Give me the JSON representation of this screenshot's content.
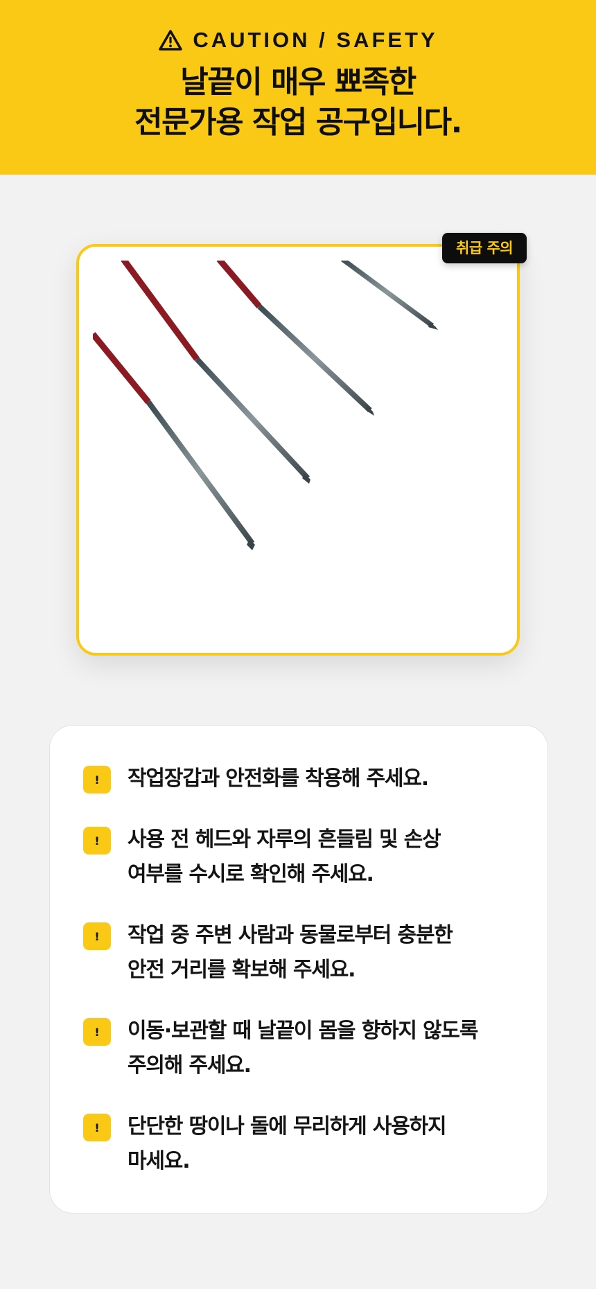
{
  "banner": {
    "caution_label": "CAUTION / SAFETY",
    "caution_icon": "warning-triangle-icon",
    "headline_line1": "날끝이 매우 뾰족한",
    "headline_line2": "전문가용 작업 공구입니다.",
    "background_color": "#f9c916"
  },
  "product_image": {
    "badge_label": "취급 주의",
    "description_icon": "sharp-hand-tools-photo"
  },
  "notes": {
    "icon_glyph": "!",
    "items": [
      {
        "text": "작업장갑과 안전화를 착용해 주세요."
      },
      {
        "line1": "사용 전 헤드와 자루의 흔들림 및 손상",
        "line2": "여부를 수시로 확인해 주세요."
      },
      {
        "line1": "작업 중 주변 사람과 동물로부터 충분한",
        "line2": "안전 거리를 확보해 주세요."
      },
      {
        "line1": "이동·보관할 때 날끝이 몸을 향하지 않도록",
        "line2": "주의해 주세요."
      },
      {
        "line1": "단단한 땅이나 돌에 무리하게 사용하지",
        "line2": "마세요."
      }
    ]
  },
  "colors": {
    "accent": "#f9c916",
    "badge_background": "#0d0d0d",
    "page_background": "#f2f2f2"
  }
}
